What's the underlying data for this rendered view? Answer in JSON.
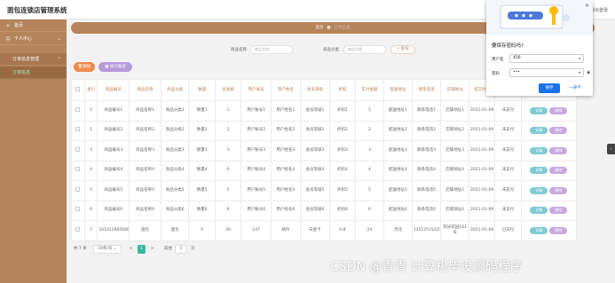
{
  "app_title": "面包连锁店管理系统",
  "topbar_right": "退出登录",
  "sidebar": {
    "items": [
      {
        "label": "首页",
        "icon": "home-icon",
        "glyph": "⌂"
      },
      {
        "label": "个人中心",
        "icon": "user-icon",
        "glyph": "☺"
      },
      {
        "label": "订单信息管理",
        "icon": "",
        "glyph": ""
      },
      {
        "label": "订单信息",
        "icon": "",
        "glyph": ""
      }
    ]
  },
  "breadcrumb": {
    "home": "首页",
    "current": "订单信息"
  },
  "search": {
    "field1_label": "商品名称",
    "field1_placeholder": "商品名称",
    "field2_label": "商品分类",
    "field2_placeholder": "商品分类",
    "button_label": "查询"
  },
  "actions": {
    "delete_label": "删除",
    "report_label": "统计报表"
  },
  "table": {
    "headers": [
      "索引",
      "商品编号",
      "商品名称",
      "商品分类",
      "数量",
      "总金额",
      "用户账号",
      "用户姓名",
      "会员等级",
      "折扣",
      "实付金额",
      "配送地址",
      "联系电话",
      "店铺地址",
      "提交时间",
      "状态",
      "操作"
    ],
    "rows": [
      [
        "1",
        "商品编号1",
        "商品名称1",
        "商品分类1",
        "数量1",
        "1",
        "用户账号1",
        "用户姓名1",
        "会员等级1",
        "折扣1",
        "1",
        "配送地址1",
        "联系电话1",
        "店铺地址1",
        "2021-01-09",
        "未支付"
      ],
      [
        "2",
        "商品编号2",
        "商品名称2",
        "商品分类2",
        "数量2",
        "2",
        "用户账号2",
        "用户姓名2",
        "会员等级2",
        "折扣2",
        "2",
        "配送地址2",
        "联系电话2",
        "店铺地址2",
        "2021-01-09",
        "未支付"
      ],
      [
        "3",
        "商品编号3",
        "商品名称3",
        "商品分类3",
        "数量3",
        "3",
        "用户账号3",
        "用户姓名3",
        "会员等级3",
        "折扣3",
        "3",
        "配送地址3",
        "联系电话3",
        "店铺地址3",
        "2021-01-09",
        "未支付"
      ],
      [
        "4",
        "商品编号4",
        "商品名称4",
        "商品分类4",
        "数量4",
        "4",
        "用户账号4",
        "用户姓名4",
        "会员等级4",
        "折扣4",
        "4",
        "配送地址4",
        "联系电话4",
        "店铺地址4",
        "2021-01-09",
        "未支付"
      ],
      [
        "5",
        "商品编号5",
        "商品名称5",
        "商品分类5",
        "数量5",
        "5",
        "用户账号5",
        "用户姓名5",
        "会员等级5",
        "折扣5",
        "5",
        "配送地址5",
        "联系电话5",
        "店铺地址5",
        "2021-01-09",
        "未支付"
      ],
      [
        "6",
        "商品编号6",
        "商品名称6",
        "商品分类6",
        "数量6",
        "6",
        "用户账号6",
        "用户姓名6",
        "会员等级6",
        "折扣6",
        "6",
        "配送地址6",
        "联系电话6",
        "店铺地址6",
        "2021-01-09",
        "未支付"
      ],
      [
        "7",
        "1610128856667",
        "面包",
        "面包",
        "0",
        "30",
        "147",
        "胡丹",
        "白金卡",
        "0.8",
        "24",
        "河北",
        "13512515225",
        "阳光花园101号",
        "2021-01-09",
        "已支付"
      ]
    ],
    "detail_label": "详情",
    "delete_label": "删除"
  },
  "pager": {
    "total": "共 7 条",
    "page_size": "10条/页",
    "prev": "<",
    "pages": [
      "1"
    ],
    "next": ">",
    "goto_label": "前往",
    "goto_value": "1",
    "page_unit": "页"
  },
  "password_popup": {
    "title": "要保存密码吗?",
    "username_label": "用户名",
    "username_value": "456",
    "password_label": "密码",
    "password_value": "•••",
    "save_label": "保存",
    "never_label": "一律不",
    "close_glyph": "✕"
  },
  "side_tab_glyph": "‹",
  "watermark": "CSDN @青青  计算机毕设源码程序",
  "colors": {
    "brand": "#b5845b",
    "detail": "#7ecad4",
    "delete": "#c8a8e0",
    "pager_active": "#3ab8a0",
    "save": "#1a73e8"
  }
}
